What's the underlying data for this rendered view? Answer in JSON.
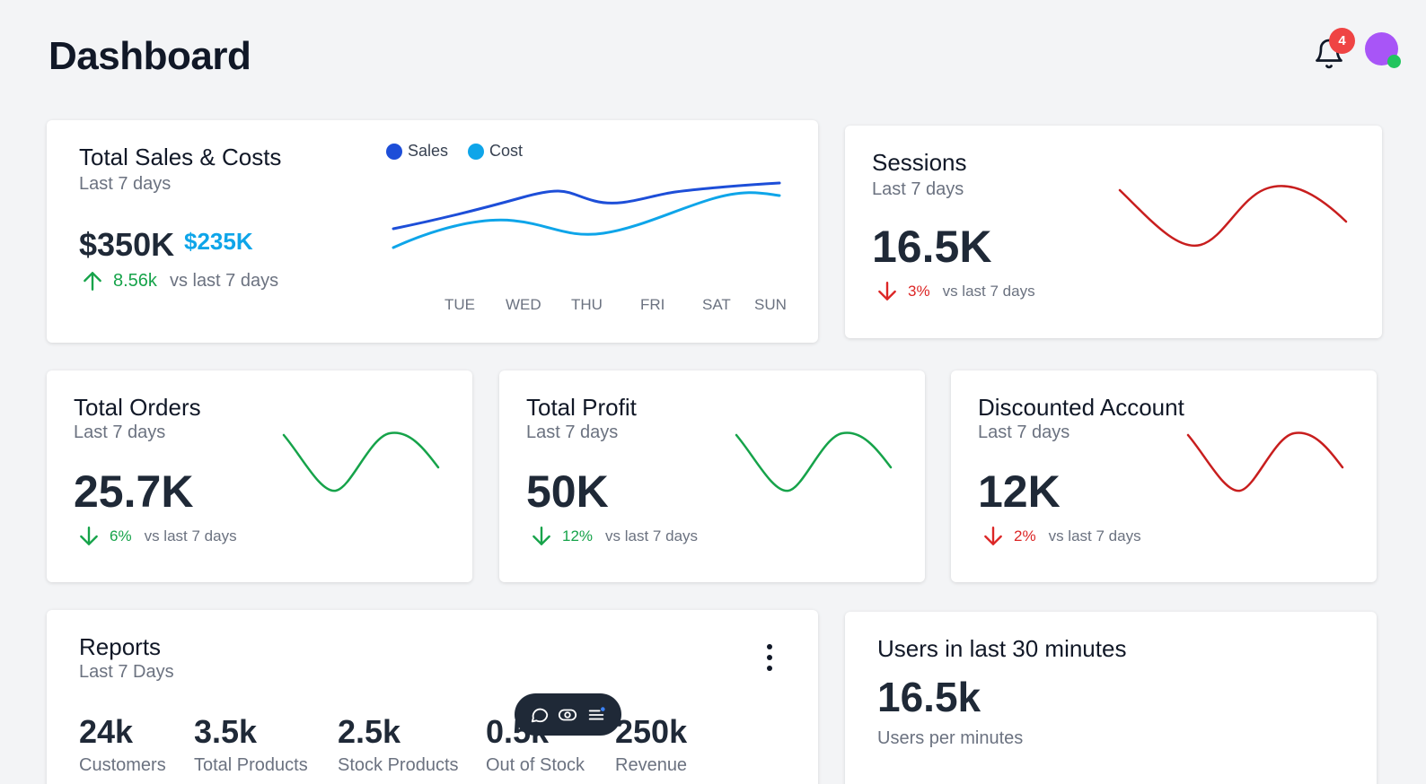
{
  "header": {
    "title": "Dashboard",
    "notification_count": "4"
  },
  "colors": {
    "sales": "#1d4ed8",
    "cost": "#0ea5e9",
    "positive": "#16a34a",
    "negative": "#dc2626"
  },
  "sales_card": {
    "title": "Total Sales & Costs",
    "subtitle": "Last 7 days",
    "sales_value": "$350K",
    "cost_value": "$235K",
    "trend_value": "8.56k",
    "trend_text": "vs last 7 days",
    "legend": [
      "Sales",
      "Cost"
    ],
    "days": [
      "TUE",
      "WED",
      "THU",
      "FRI",
      "SAT",
      "SUN"
    ]
  },
  "sessions_card": {
    "title": "Sessions",
    "subtitle": "Last 7 days",
    "value": "16.5K",
    "trend_value": "3%",
    "trend_text": "vs last 7 days"
  },
  "orders_card": {
    "title": "Total Orders",
    "subtitle": "Last 7 days",
    "value": "25.7K",
    "trend_value": "6%",
    "trend_text": "vs last 7 days"
  },
  "profit_card": {
    "title": "Total Profit",
    "subtitle": "Last 7 days",
    "value": "50K",
    "trend_value": "12%",
    "trend_text": "vs last 7 days"
  },
  "discount_card": {
    "title": "Discounted Account",
    "subtitle": "Last 7 days",
    "value": "12K",
    "trend_value": "2%",
    "trend_text": "vs last 7 days"
  },
  "reports_card": {
    "title": "Reports",
    "subtitle": "Last 7 Days",
    "stats": [
      {
        "value": "24k",
        "label": "Customers"
      },
      {
        "value": "3.5k",
        "label": "Total Products"
      },
      {
        "value": "2.5k",
        "label": "Stock Products"
      },
      {
        "value": "0.5k",
        "label": "Out of Stock"
      },
      {
        "value": "250k",
        "label": "Revenue"
      }
    ]
  },
  "users_card": {
    "title": "Users in last 30 minutes",
    "value": "16.5k",
    "subtitle": "Users per minutes"
  },
  "toolbar": {
    "icons": [
      "comment-icon",
      "eye-icon",
      "list-icon"
    ]
  }
}
